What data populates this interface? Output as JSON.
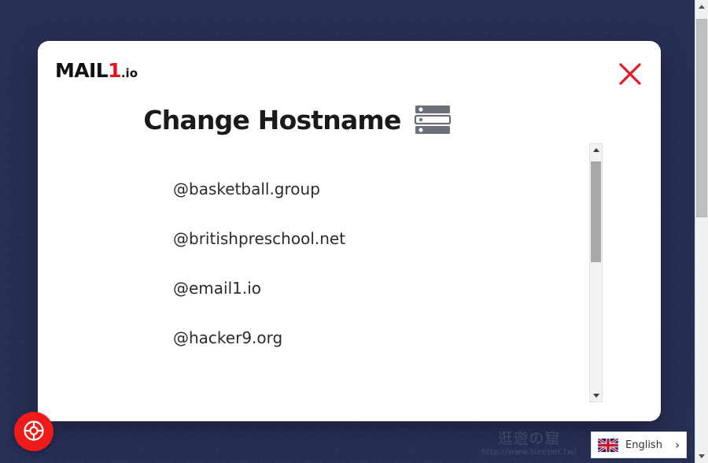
{
  "brand": {
    "logo_main": "MAIL",
    "logo_digit": "1",
    "logo_suffix": ".io",
    "accent_color": "#e8141b"
  },
  "modal": {
    "title": "Change Hostname",
    "title_icon": "server-rack-icon",
    "close_icon": "close-x-icon",
    "close_color": "#e01b24",
    "hostnames": [
      {
        "label": "@basketball.group"
      },
      {
        "label": "@britishpreschool.net"
      },
      {
        "label": "@email1.io"
      },
      {
        "label": "@hacker9.org"
      }
    ]
  },
  "inner_scrollbar": {
    "up_icon": "scroll-up-arrow-icon",
    "down_icon": "scroll-down-arrow-icon",
    "thumb_color": "#a8a8a8"
  },
  "browser_scrollbar": {
    "up_icon": "scroll-up-arrow-icon",
    "down_icon": "scroll-down-arrow-icon",
    "thumb_color": "#c0c0c0"
  },
  "help": {
    "icon": "lifebuoy-icon",
    "color": "#ef1b1b"
  },
  "language": {
    "flag_icon": "uk-flag-icon",
    "label": "English",
    "chevron": "›"
  },
  "watermark": {
    "cjk": "逛遊の窟",
    "url": "http://www.sleeper.tw/"
  },
  "page": {
    "background_color": "#272f55"
  }
}
